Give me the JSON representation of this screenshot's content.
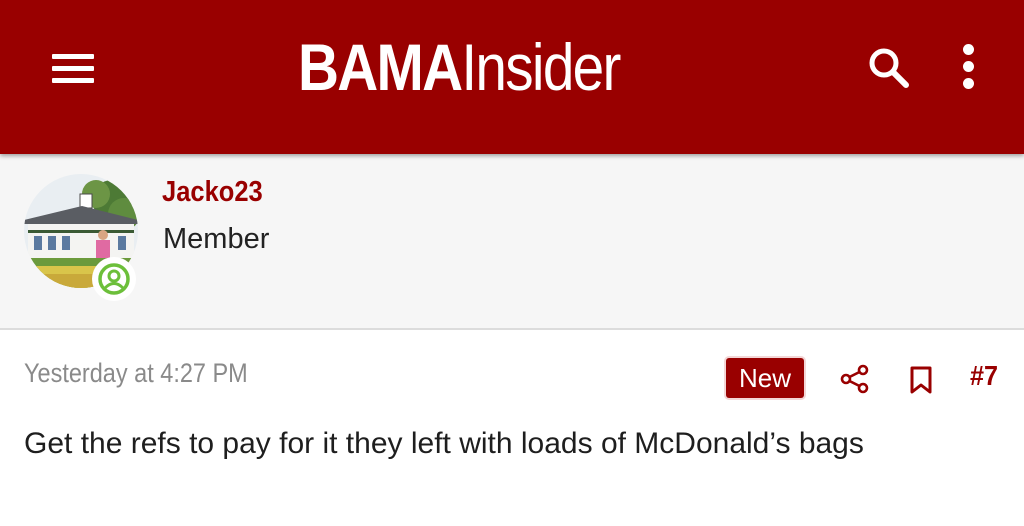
{
  "header": {
    "logo_bold": "BAMA",
    "logo_thin": "Insider",
    "menu_icon": "hamburger-menu-icon",
    "search_icon": "search-icon",
    "more_icon": "vertical-ellipsis-icon",
    "background_color": "#990000"
  },
  "user": {
    "username": "Jacko23",
    "title": "Member",
    "status_icon": "online-user-icon",
    "status_color": "#6cbf3a"
  },
  "post": {
    "date": "Yesterday at 4:27 PM",
    "new_badge": "New",
    "share_icon": "share-icon",
    "bookmark_icon": "bookmark-icon",
    "number": "#7",
    "body": "Get the refs to pay for it they left with loads of McDonald’s bags"
  }
}
